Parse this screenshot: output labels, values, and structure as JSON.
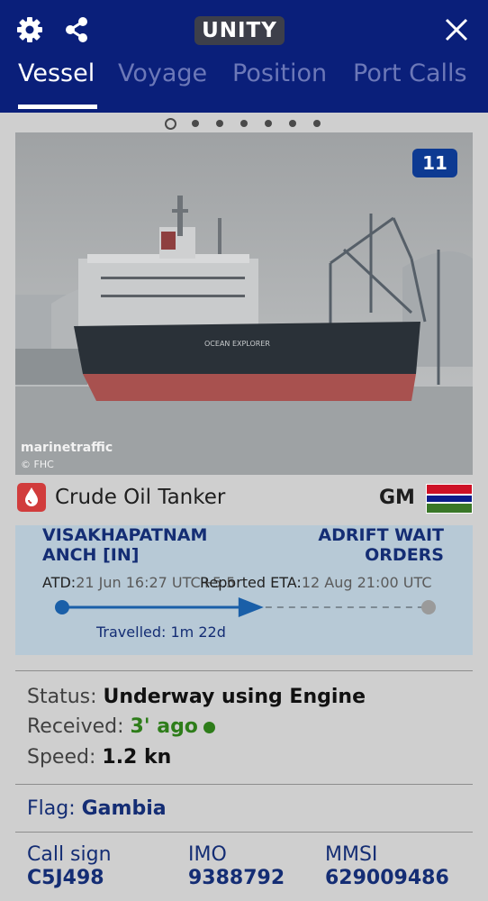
{
  "header": {
    "brand": "UNITY",
    "tabs": [
      {
        "label": "Vessel",
        "active": true
      },
      {
        "label": "Voyage",
        "active": false
      },
      {
        "label": "Position",
        "active": false
      },
      {
        "label": "Port Calls",
        "active": false
      }
    ],
    "icons": [
      "gear-icon",
      "share-icon",
      "close-icon"
    ]
  },
  "gallery": {
    "page_count": 7,
    "current_page": 1,
    "photo_count": "11",
    "watermark": "marinetraffic",
    "credit": "© FHC"
  },
  "vessel": {
    "type": "Crude Oil Tanker",
    "country_code": "GM",
    "type_icon_color": "#d13c3c"
  },
  "route": {
    "origin": "VISAKHAPATNAM ANCH [IN]",
    "destination": "ADRIFT WAIT ORDERS",
    "atd_label": "ATD:",
    "atd_value": "21 Jun 16:27 UTC+5.5",
    "eta_label": "Reported ETA:",
    "eta_value": "12 Aug 21:00 UTC",
    "travelled": "Travelled: 1m 22d",
    "progress": 0.55
  },
  "status": {
    "status_label": "Status:",
    "status_value": "Underway using Engine",
    "received_label": "Received:",
    "received_value": "3' ago",
    "speed_label": "Speed:",
    "speed_value": "1.2 kn"
  },
  "flag": {
    "label": "Flag:",
    "value": "Gambia"
  },
  "identifiers": {
    "call_sign_label": "Call sign",
    "call_sign_value": "C5J498",
    "imo_label": "IMO",
    "imo_value": "9388792",
    "mmsi_label": "MMSI",
    "mmsi_value": "629009486"
  },
  "colors": {
    "header_bg": "#0a1f7a",
    "accent": "#142d74",
    "route_bg": "#b7c9d6",
    "progress": "#1a5fa8",
    "live": "#2e7d1a"
  }
}
